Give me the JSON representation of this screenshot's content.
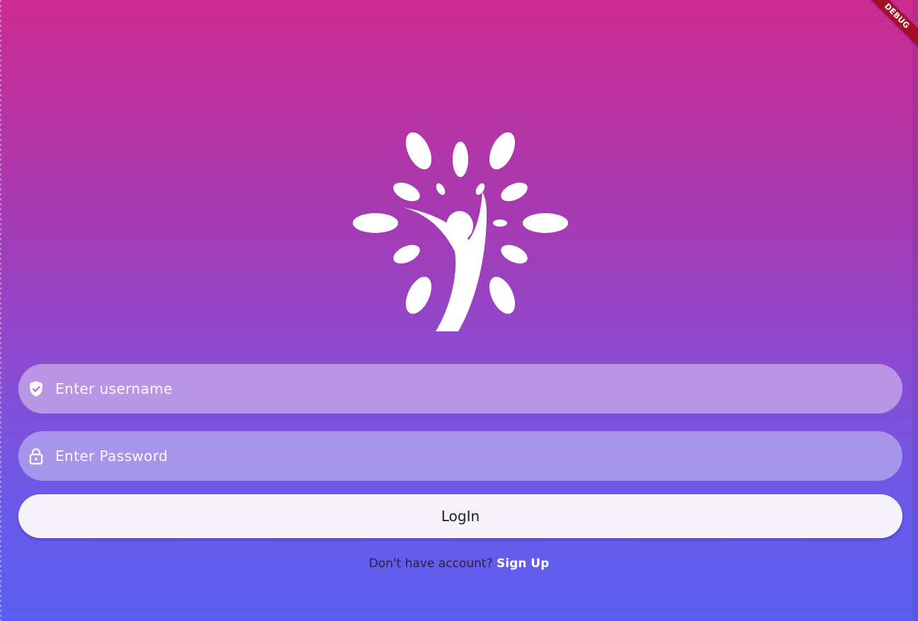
{
  "banner": {
    "text": "DEBUG"
  },
  "logo": {
    "icon": "tree-person-icon"
  },
  "username": {
    "placeholder": "Enter username",
    "value": "",
    "icon": "verified-shield-icon"
  },
  "password": {
    "placeholder": "Enter Password",
    "value": "",
    "icon": "lock-icon"
  },
  "login": {
    "label": "LogIn"
  },
  "signup": {
    "prompt": "Don't have account?",
    "link": "Sign Up"
  },
  "colors": {
    "gradient_top": "#cc2b91",
    "gradient_bottom": "#5b5ff0",
    "button_bg": "#f6f2fa",
    "debug_banner": "#a4102a"
  }
}
